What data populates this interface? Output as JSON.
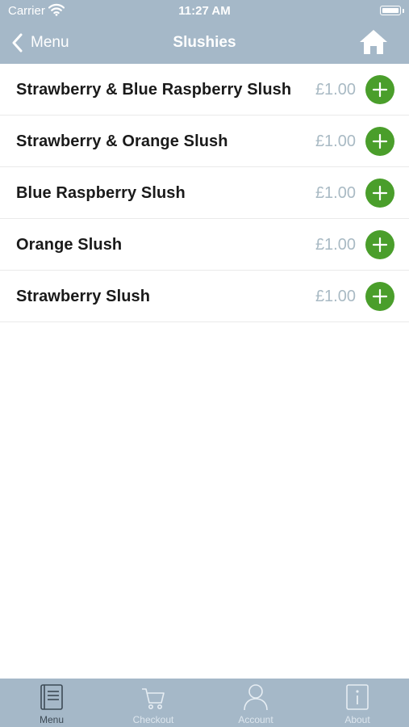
{
  "status_bar": {
    "carrier": "Carrier",
    "time": "11:27 AM"
  },
  "nav": {
    "back_label": "Menu",
    "title": "Slushies",
    "home_icon": "home-icon"
  },
  "items": [
    {
      "name": "Strawberry & Blue Raspberry Slush",
      "price": "£1.00"
    },
    {
      "name": "Strawberry & Orange Slush",
      "price": "£1.00"
    },
    {
      "name": "Blue Raspberry Slush",
      "price": "£1.00"
    },
    {
      "name": "Orange Slush",
      "price": "£1.00"
    },
    {
      "name": "Strawberry Slush",
      "price": "£1.00"
    }
  ],
  "tabs": [
    {
      "label": "Menu",
      "icon": "menu-book-icon",
      "active": true
    },
    {
      "label": "Checkout",
      "icon": "cart-icon",
      "active": false
    },
    {
      "label": "Account",
      "icon": "user-icon",
      "active": false
    },
    {
      "label": "About",
      "icon": "info-icon",
      "active": false
    }
  ],
  "colors": {
    "bar": "#a5b8c8",
    "add_button": "#4a9e2b",
    "price": "#a9bac4"
  }
}
